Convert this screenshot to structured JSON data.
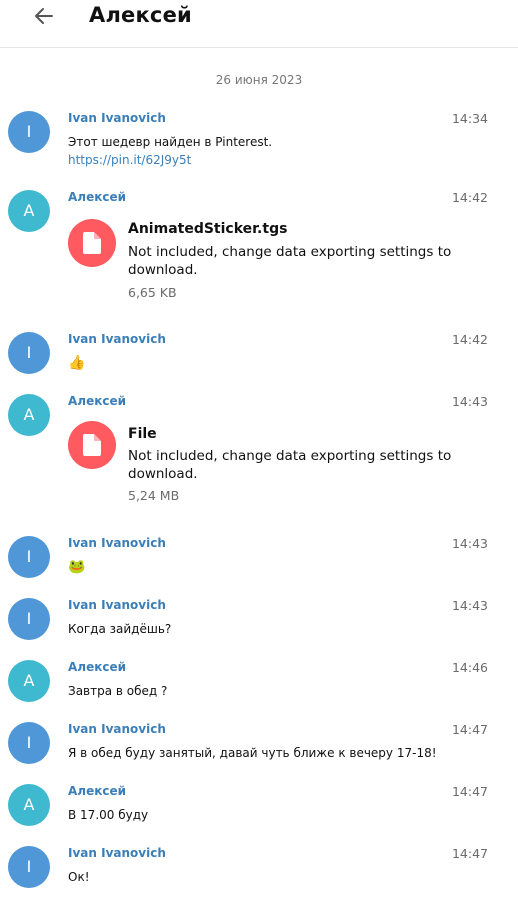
{
  "header": {
    "title": "Алексей"
  },
  "date_divider": "26 июня 2023",
  "messages": [
    {
      "author": "Ivan Ivanovich",
      "avatar": "I",
      "time": "14:34",
      "text": "Этот шедевр найден в Pinterest.",
      "link": "https://pin.it/62J9y5t"
    },
    {
      "author": "Алексей",
      "avatar": "А",
      "time": "14:42",
      "file": {
        "name": "AnimatedSticker.tgs",
        "desc": "Not included, change data exporting settings to download.",
        "size": "6,65 KB"
      }
    },
    {
      "author": "Ivan Ivanovich",
      "avatar": "I",
      "time": "14:42",
      "emoji": "👍"
    },
    {
      "author": "Алексей",
      "avatar": "А",
      "time": "14:43",
      "file": {
        "name": "File",
        "desc": "Not included, change data exporting settings to download.",
        "size": "5,24 MB"
      }
    },
    {
      "author": "Ivan Ivanovich",
      "avatar": "I",
      "time": "14:43",
      "emoji": "🐸"
    },
    {
      "author": "Ivan Ivanovich",
      "avatar": "I",
      "time": "14:43",
      "text": "Когда зайдёшь?"
    },
    {
      "author": "Алексей",
      "avatar": "А",
      "time": "14:46",
      "text": "Завтра в обед ?"
    },
    {
      "author": "Ivan Ivanovich",
      "avatar": "I",
      "time": "14:47",
      "text": "Я в обед буду занятый, давай чуть ближе к вечеру 17-18!"
    },
    {
      "author": "Алексей",
      "avatar": "А",
      "time": "14:47",
      "text": "В 17.00 буду"
    },
    {
      "author": "Ivan Ivanovich",
      "avatar": "I",
      "time": "14:47",
      "text": "Ок!"
    }
  ]
}
